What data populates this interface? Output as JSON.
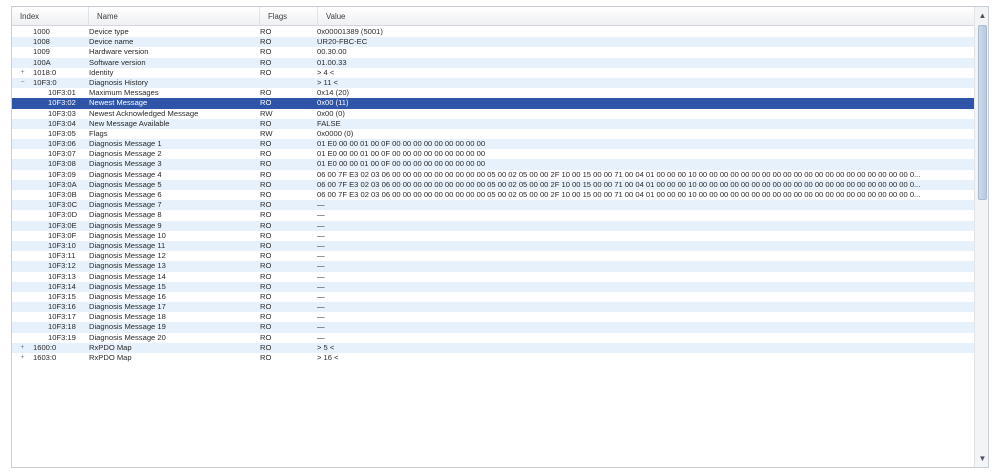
{
  "columns": {
    "index": "Index",
    "name": "Name",
    "flags": "Flags",
    "value": "Value"
  },
  "rows": [
    {
      "index": "1000",
      "expander": "minus-line",
      "depth": 0,
      "name": "Device type",
      "flags": "RO",
      "value": "0x00001389 (5001)"
    },
    {
      "index": "1008",
      "expander": "",
      "depth": 0,
      "name": "Device name",
      "flags": "RO",
      "value": "UR20-FBC-EC"
    },
    {
      "index": "1009",
      "expander": "",
      "depth": 0,
      "name": "Hardware version",
      "flags": "RO",
      "value": "00.30.00"
    },
    {
      "index": "100A",
      "expander": "",
      "depth": 0,
      "name": "Software version",
      "flags": "RO",
      "value": "01.00.33"
    },
    {
      "index": "1018:0",
      "expander": "+",
      "depth": 0,
      "name": "Identity",
      "flags": "RO",
      "value": "> 4 <"
    },
    {
      "index": "10F3:0",
      "expander": "−",
      "depth": 0,
      "name": "Diagnosis History",
      "flags": "",
      "value": "> 11 <"
    },
    {
      "index": "10F3:01",
      "expander": "",
      "depth": 1,
      "name": "Maximum Messages",
      "flags": "RO",
      "value": "0x14 (20)"
    },
    {
      "index": "10F3:02",
      "expander": "",
      "depth": 1,
      "name": "Newest Message",
      "flags": "RO",
      "value": "0x00 (11)"
    },
    {
      "index": "10F3:03",
      "expander": "",
      "depth": 1,
      "name": "Newest Acknowledged Message",
      "flags": "RW",
      "value": "0x00 (0)"
    },
    {
      "index": "10F3:04",
      "expander": "",
      "depth": 1,
      "name": "New Message Available",
      "flags": "RO",
      "value": "FALSE"
    },
    {
      "index": "10F3:05",
      "expander": "",
      "depth": 1,
      "name": "Flags",
      "flags": "RW",
      "value": "0x0000 (0)"
    },
    {
      "index": "10F3:06",
      "expander": "",
      "depth": 1,
      "name": "Diagnosis Message 1",
      "flags": "RO",
      "value": "01 E0 00 00 01 00 0F 00 00 00 00 00 00 00 00 00"
    },
    {
      "index": "10F3:07",
      "expander": "",
      "depth": 1,
      "name": "Diagnosis Message 2",
      "flags": "RO",
      "value": "01 E0 00 00 01 00 0F 00 00 00 00 00 00 00 00 00"
    },
    {
      "index": "10F3:08",
      "expander": "",
      "depth": 1,
      "name": "Diagnosis Message 3",
      "flags": "RO",
      "value": "01 E0 00 00 01 00 0F 00 00 00 00 00 00 00 00 00"
    },
    {
      "index": "10F3:09",
      "expander": "",
      "depth": 1,
      "name": "Diagnosis Message 4",
      "flags": "RO",
      "value": "06 00 7F E3 02 03 06 00 00 00 00 00 00 00 00 00 05 00 02 05 00 00 2F 10 00 15 00 00 71 00 04 01 00 00 00 10 00 00 00 00 00 00 00 00 00 00 00 00 00 00 00 00 00 00 00 00 0..."
    },
    {
      "index": "10F3:0A",
      "expander": "",
      "depth": 1,
      "name": "Diagnosis Message 5",
      "flags": "RO",
      "value": "06 00 7F E3 02 03 06 00 00 00 00 00 00 00 00 00 05 00 02 05 00 00 2F 10 00 15 00 00 71 00 04 01 00 00 00 10 00 00 00 00 00 00 00 00 00 00 00 00 00 00 00 00 00 00 00 00 0..."
    },
    {
      "index": "10F3:0B",
      "expander": "",
      "depth": 1,
      "name": "Diagnosis Message 6",
      "flags": "RO",
      "value": "06 00 7F E3 02 03 06 00 00 00 00 00 00 00 00 00 05 00 02 05 00 00 2F 10 00 15 00 00 71 00 04 01 00 00 00 10 00 00 00 00 00 00 00 00 00 00 00 00 00 00 00 00 00 00 00 00 0..."
    },
    {
      "index": "10F3:0C",
      "expander": "",
      "depth": 1,
      "name": "Diagnosis Message 7",
      "flags": "RO",
      "value": "—"
    },
    {
      "index": "10F3:0D",
      "expander": "",
      "depth": 1,
      "name": "Diagnosis Message 8",
      "flags": "RO",
      "value": "—"
    },
    {
      "index": "10F3:0E",
      "expander": "",
      "depth": 1,
      "name": "Diagnosis Message 9",
      "flags": "RO",
      "value": "—"
    },
    {
      "index": "10F3:0F",
      "expander": "",
      "depth": 1,
      "name": "Diagnosis Message 10",
      "flags": "RO",
      "value": "—"
    },
    {
      "index": "10F3:10",
      "expander": "",
      "depth": 1,
      "name": "Diagnosis Message 11",
      "flags": "RO",
      "value": "—"
    },
    {
      "index": "10F3:11",
      "expander": "",
      "depth": 1,
      "name": "Diagnosis Message 12",
      "flags": "RO",
      "value": "—"
    },
    {
      "index": "10F3:12",
      "expander": "",
      "depth": 1,
      "name": "Diagnosis Message 13",
      "flags": "RO",
      "value": "—"
    },
    {
      "index": "10F3:13",
      "expander": "",
      "depth": 1,
      "name": "Diagnosis Message 14",
      "flags": "RO",
      "value": "—"
    },
    {
      "index": "10F3:14",
      "expander": "",
      "depth": 1,
      "name": "Diagnosis Message 15",
      "flags": "RO",
      "value": "—"
    },
    {
      "index": "10F3:15",
      "expander": "",
      "depth": 1,
      "name": "Diagnosis Message 16",
      "flags": "RO",
      "value": "—"
    },
    {
      "index": "10F3:16",
      "expander": "",
      "depth": 1,
      "name": "Diagnosis Message 17",
      "flags": "RO",
      "value": "—"
    },
    {
      "index": "10F3:17",
      "expander": "",
      "depth": 1,
      "name": "Diagnosis Message 18",
      "flags": "RO",
      "value": "—"
    },
    {
      "index": "10F3:18",
      "expander": "",
      "depth": 1,
      "name": "Diagnosis Message 19",
      "flags": "RO",
      "value": "—"
    },
    {
      "index": "10F3:19",
      "expander": "",
      "depth": 1,
      "name": "Diagnosis Message 20",
      "flags": "RO",
      "value": "—"
    },
    {
      "index": "1600:0",
      "expander": "+",
      "depth": 0,
      "name": "RxPDO Map",
      "flags": "RO",
      "value": "> 5 <"
    },
    {
      "index": "1603:0",
      "expander": "+",
      "depth": 0,
      "name": "RxPDO Map",
      "flags": "RO",
      "value": "> 16 <"
    }
  ],
  "selected_row_index": 7,
  "colors": {
    "selection": "#2f55a8",
    "alt_row": "#e6f1fb"
  },
  "scrollbar": {
    "up_icon": "chevron-up-icon",
    "down_icon": "chevron-down-icon"
  }
}
